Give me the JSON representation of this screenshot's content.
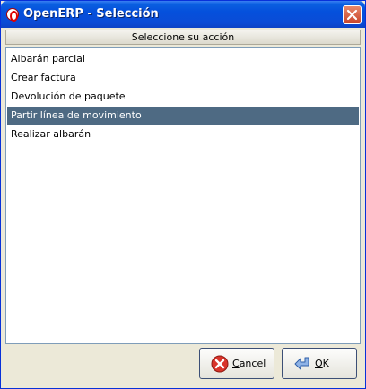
{
  "window": {
    "title": "OpenERP - Selección",
    "app_icon": "openerp-logo-icon",
    "close_icon": "close-icon"
  },
  "dialog": {
    "header": "Seleccione su acción",
    "items": [
      {
        "label": "Albarán parcial"
      },
      {
        "label": "Crear factura"
      },
      {
        "label": "Devolución de paquete"
      },
      {
        "label": "Partir línea de movimiento"
      },
      {
        "label": "Realizar albarán"
      }
    ],
    "selected_index": 3,
    "selection_color": "#4e6a83"
  },
  "buttons": {
    "cancel": {
      "label": "Cancel",
      "icon": "cancel-icon"
    },
    "ok": {
      "label": "OK",
      "icon": "ok-arrow-icon"
    }
  }
}
